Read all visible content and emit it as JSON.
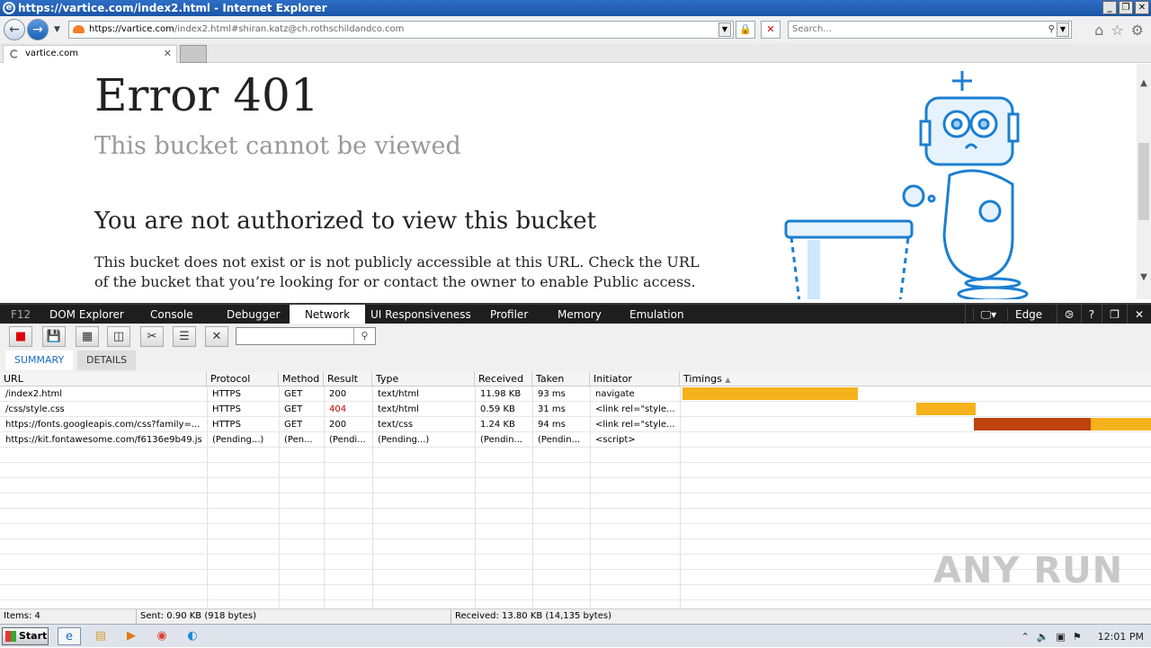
{
  "window": {
    "title": "https://vartice.com/index2.html - Internet Explorer",
    "controls": [
      "_",
      "❐",
      "✕"
    ]
  },
  "address": {
    "host": "https://vartice.com",
    "rest": "/index2.html#shiran.katz@ch.rothschildandco.com",
    "search_placeholder": "Search..."
  },
  "tab": {
    "label": "vartice.com",
    "close": "✕"
  },
  "page": {
    "heading": "Error 401",
    "subheading": "This bucket cannot be viewed",
    "title": "You are not authorized to view this bucket",
    "body": "This bucket does not exist or is not publicly accessible at this URL. Check the URL of the bucket that you’re looking for or contact the owner to enable Public access."
  },
  "devtools": {
    "tabs": [
      "F12",
      "DOM Explorer",
      "Console",
      "Debugger",
      "Network",
      "UI Responsiveness",
      "Profiler",
      "Memory",
      "Emulation"
    ],
    "active_tab": "Network",
    "browser_mode": "Edge",
    "view_tabs": [
      "SUMMARY",
      "DETAILS"
    ],
    "columns": [
      "URL",
      "Protocol",
      "Method",
      "Result",
      "Type",
      "Received",
      "Taken",
      "Initiator",
      "Timings"
    ],
    "rows": [
      {
        "url": "/index2.html",
        "protocol": "HTTPS",
        "method": "GET",
        "result": "200",
        "type": "text/html",
        "received": "11.98 KB",
        "taken": "93 ms",
        "initiator": "navigate"
      },
      {
        "url": "/css/style.css",
        "protocol": "HTTPS",
        "method": "GET",
        "result": "404",
        "type": "text/html",
        "received": "0.59 KB",
        "taken": "31 ms",
        "initiator": "<link rel=\"style..."
      },
      {
        "url": "https://fonts.googleapis.com/css?family=...",
        "protocol": "HTTPS",
        "method": "GET",
        "result": "200",
        "type": "text/css",
        "received": "1.24 KB",
        "taken": "94 ms",
        "initiator": "<link rel=\"style..."
      },
      {
        "url": "https://kit.fontawesome.com/f6136e9b49.js",
        "protocol": "(Pending...)",
        "method": "(Pen...",
        "result": "(Pendi...",
        "type": "(Pending...)",
        "received": "(Pendin...",
        "taken": "(Pendin...",
        "initiator": "<script>"
      }
    ],
    "status": {
      "items": "Items: 4",
      "sent": "Sent: 0.90 KB (918 bytes)",
      "received": "Received: 13.80 KB (14,135 bytes)"
    },
    "colors": {
      "error_result": "#c00000",
      "timing_bar": "#f5b21c",
      "timing_wait": "#c0420e"
    }
  },
  "taskbar": {
    "start_label": "Start",
    "clock": "12:01 PM"
  },
  "watermark": "ANY RUN"
}
